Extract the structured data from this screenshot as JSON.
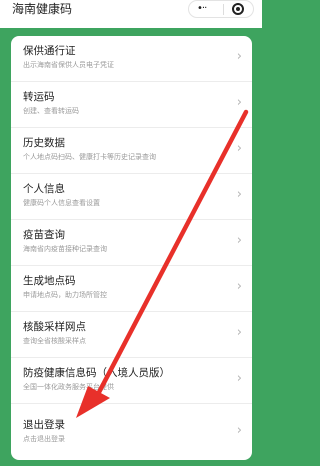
{
  "header": {
    "title": "海南健康码",
    "more_icon": "more-dots-icon",
    "close_icon": "target-circle-icon"
  },
  "menu": {
    "items": [
      {
        "title": "保供通行证",
        "subtitle": "出示海南省保供人员电子凭证"
      },
      {
        "title": "转运码",
        "subtitle": "创建、查看转运码"
      },
      {
        "title": "历史数据",
        "subtitle": "个人地点码扫码、健康打卡等历史记录查询"
      },
      {
        "title": "个人信息",
        "subtitle": "健康码个人信息查看设置"
      },
      {
        "title": "疫苗查询",
        "subtitle": "海南省内疫苗接种记录查询"
      },
      {
        "title": "生成地点码",
        "subtitle": "申请地点码，助力场所管控"
      },
      {
        "title": "核酸采样网点",
        "subtitle": "查询全省核酸采样点"
      },
      {
        "title": "防疫健康信息码（入境人员版）",
        "subtitle": "全国一体化政务服务平台提供"
      },
      {
        "title": "退出登录",
        "subtitle": "点击退出登录"
      }
    ],
    "chevron": "›"
  },
  "colors": {
    "background": "#3ea45f",
    "card": "#ffffff",
    "arrow": "#e8302a"
  }
}
